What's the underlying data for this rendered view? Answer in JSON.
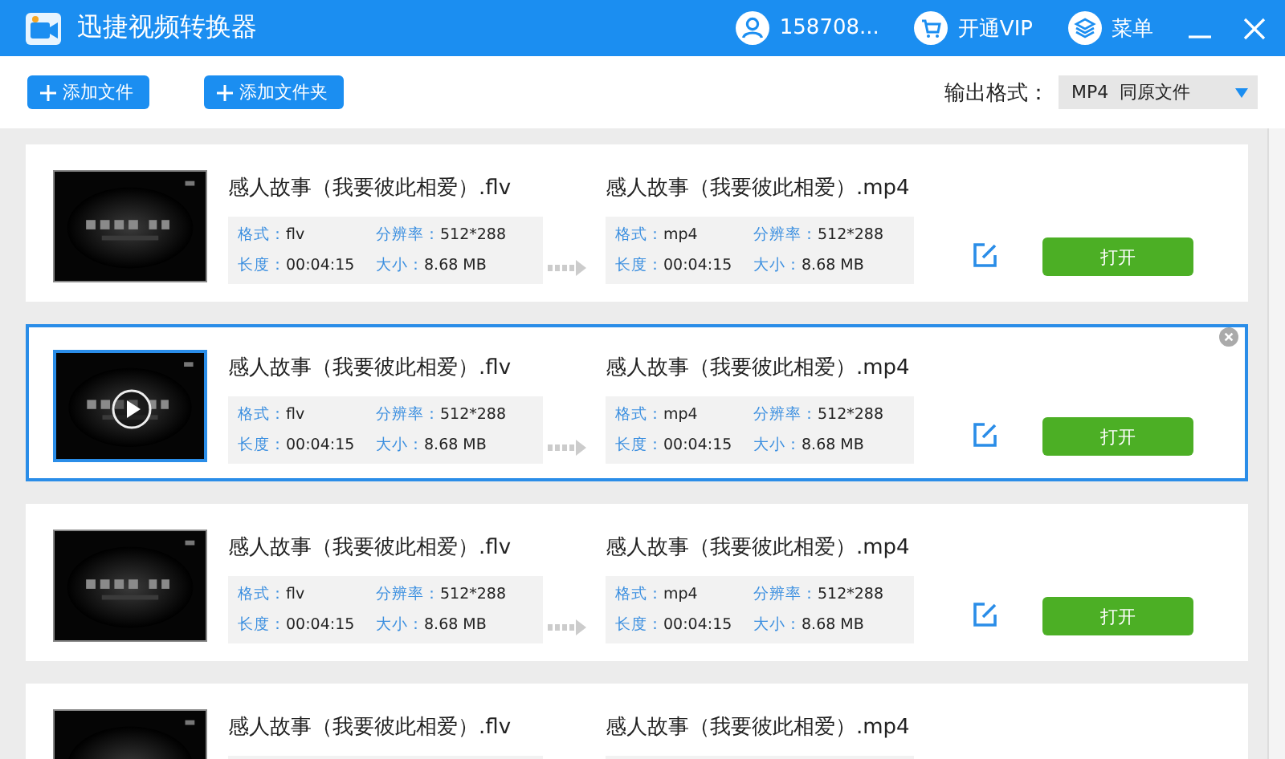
{
  "window": {
    "title": "迅捷视频转换器",
    "user": "158708...",
    "vip": "开通VIP",
    "menu": "菜单"
  },
  "toolbar": {
    "buttons": [
      "添加文件",
      "添加文件夹"
    ],
    "output_label": "输出格式：",
    "output_format": "MP4  同原文件"
  },
  "files": [
    {
      "selected": false,
      "source": {
        "name": "感人故事（我要彼此相爱）.flv",
        "format_label": "格式：",
        "format": "flv",
        "resolution_label": "分辨率：",
        "resolution": "512*288",
        "duration_label": "长度：",
        "duration": "00:04:15",
        "size_label": "大小：",
        "size": "8.68 MB"
      },
      "target": {
        "name": "感人故事（我要彼此相爱）.mp4",
        "format_label": "格式：",
        "format": "mp4",
        "resolution_label": "分辨率：",
        "resolution": "512*288",
        "duration_label": "长度：",
        "duration": "00:04:15",
        "size_label": "大小：",
        "size": "8.68 MB"
      },
      "action": "打开"
    },
    {
      "selected": true,
      "source": {
        "name": "感人故事（我要彼此相爱）.flv",
        "format_label": "格式：",
        "format": "flv",
        "resolution_label": "分辨率：",
        "resolution": "512*288",
        "duration_label": "长度：",
        "duration": "00:04:15",
        "size_label": "大小：",
        "size": "8.68 MB"
      },
      "target": {
        "name": "感人故事（我要彼此相爱）.mp4",
        "format_label": "格式：",
        "format": "mp4",
        "resolution_label": "分辨率：",
        "resolution": "512*288",
        "duration_label": "长度：",
        "duration": "00:04:15",
        "size_label": "大小：",
        "size": "8.68 MB"
      },
      "action": "打开"
    },
    {
      "selected": false,
      "source": {
        "name": "感人故事（我要彼此相爱）.flv",
        "format_label": "格式：",
        "format": "flv",
        "resolution_label": "分辨率：",
        "resolution": "512*288",
        "duration_label": "长度：",
        "duration": "00:04:15",
        "size_label": "大小：",
        "size": "8.68 MB"
      },
      "target": {
        "name": "感人故事（我要彼此相爱）.mp4",
        "format_label": "格式：",
        "format": "mp4",
        "resolution_label": "分辨率：",
        "resolution": "512*288",
        "duration_label": "长度：",
        "duration": "00:04:15",
        "size_label": "大小：",
        "size": "8.68 MB"
      },
      "action": "打开"
    },
    {
      "selected": false,
      "source": {
        "name": "感人故事（我要彼此相爱）.flv"
      },
      "target": {
        "name": "感人故事（我要彼此相爱）.mp4"
      }
    }
  ]
}
